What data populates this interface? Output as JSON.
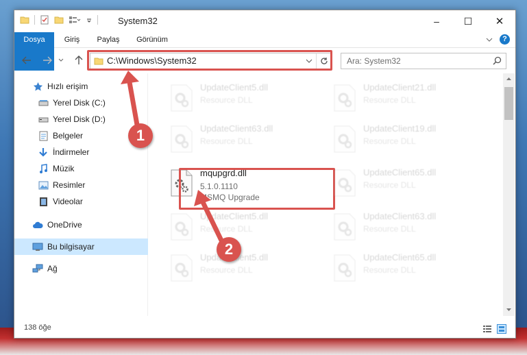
{
  "window": {
    "title": "System32",
    "buttons": {
      "minimize": "–",
      "maximize": "☐",
      "close": "✕"
    }
  },
  "ribbon": {
    "tabs": [
      "Dosya",
      "Giriş",
      "Paylaş",
      "Görünüm"
    ],
    "help_icon": "?"
  },
  "address": {
    "path": "C:\\Windows\\System32",
    "search_placeholder": "Ara: System32"
  },
  "navpane": {
    "items": [
      {
        "label": "Hızlı erişim",
        "icon": "star-icon"
      },
      {
        "label": "Yerel Disk (C:)",
        "icon": "drive-icon",
        "pinned": true
      },
      {
        "label": "Yerel Disk (D:)",
        "icon": "drive-icon",
        "pinned": true
      },
      {
        "label": "Belgeler",
        "icon": "documents-icon",
        "pinned": true
      },
      {
        "label": "İndirmeler",
        "icon": "download-icon",
        "pinned": true
      },
      {
        "label": "Müzik",
        "icon": "music-icon",
        "pinned": true
      },
      {
        "label": "Resimler",
        "icon": "pictures-icon",
        "pinned": true
      },
      {
        "label": "Videolar",
        "icon": "videos-icon",
        "pinned": true
      },
      {
        "label": "OneDrive",
        "icon": "cloud-icon"
      },
      {
        "label": "Bu bilgisayar",
        "icon": "computer-icon",
        "selected": true
      },
      {
        "label": "Ağ",
        "icon": "network-icon"
      }
    ]
  },
  "files": {
    "left": [
      {
        "name": "UpdateClient5.dll",
        "type": "Resource DLL"
      },
      {
        "name": "UpdateClient63.dll",
        "type": "Resource DLL"
      },
      {
        "name": "mqupgrd.dll",
        "version": "5.1.0.1110",
        "desc": "MSMQ Upgrade"
      },
      {
        "name": "UpdateClient5.dll",
        "type": "Resource DLL"
      },
      {
        "name": "UpdateClient5.dll",
        "type": "Resource DLL"
      }
    ],
    "right": [
      {
        "name": "UpdateClient21.dll",
        "type": "Resource DLL"
      },
      {
        "name": "UpdateClient19.dll",
        "type": "Resource DLL"
      },
      {
        "name": "UpdateClient65.dll",
        "type": "Resource DLL"
      },
      {
        "name": "UpdateClient63.dll",
        "type": "Resource DLL"
      },
      {
        "name": "UpdateClient65.dll",
        "type": "Resource DLL"
      }
    ]
  },
  "status": {
    "count": "138 öğe"
  },
  "callouts": {
    "one": "1",
    "two": "2"
  },
  "colors": {
    "accent": "#1979ca",
    "highlight": "#d9534f",
    "selected_bg": "#cce8ff"
  }
}
